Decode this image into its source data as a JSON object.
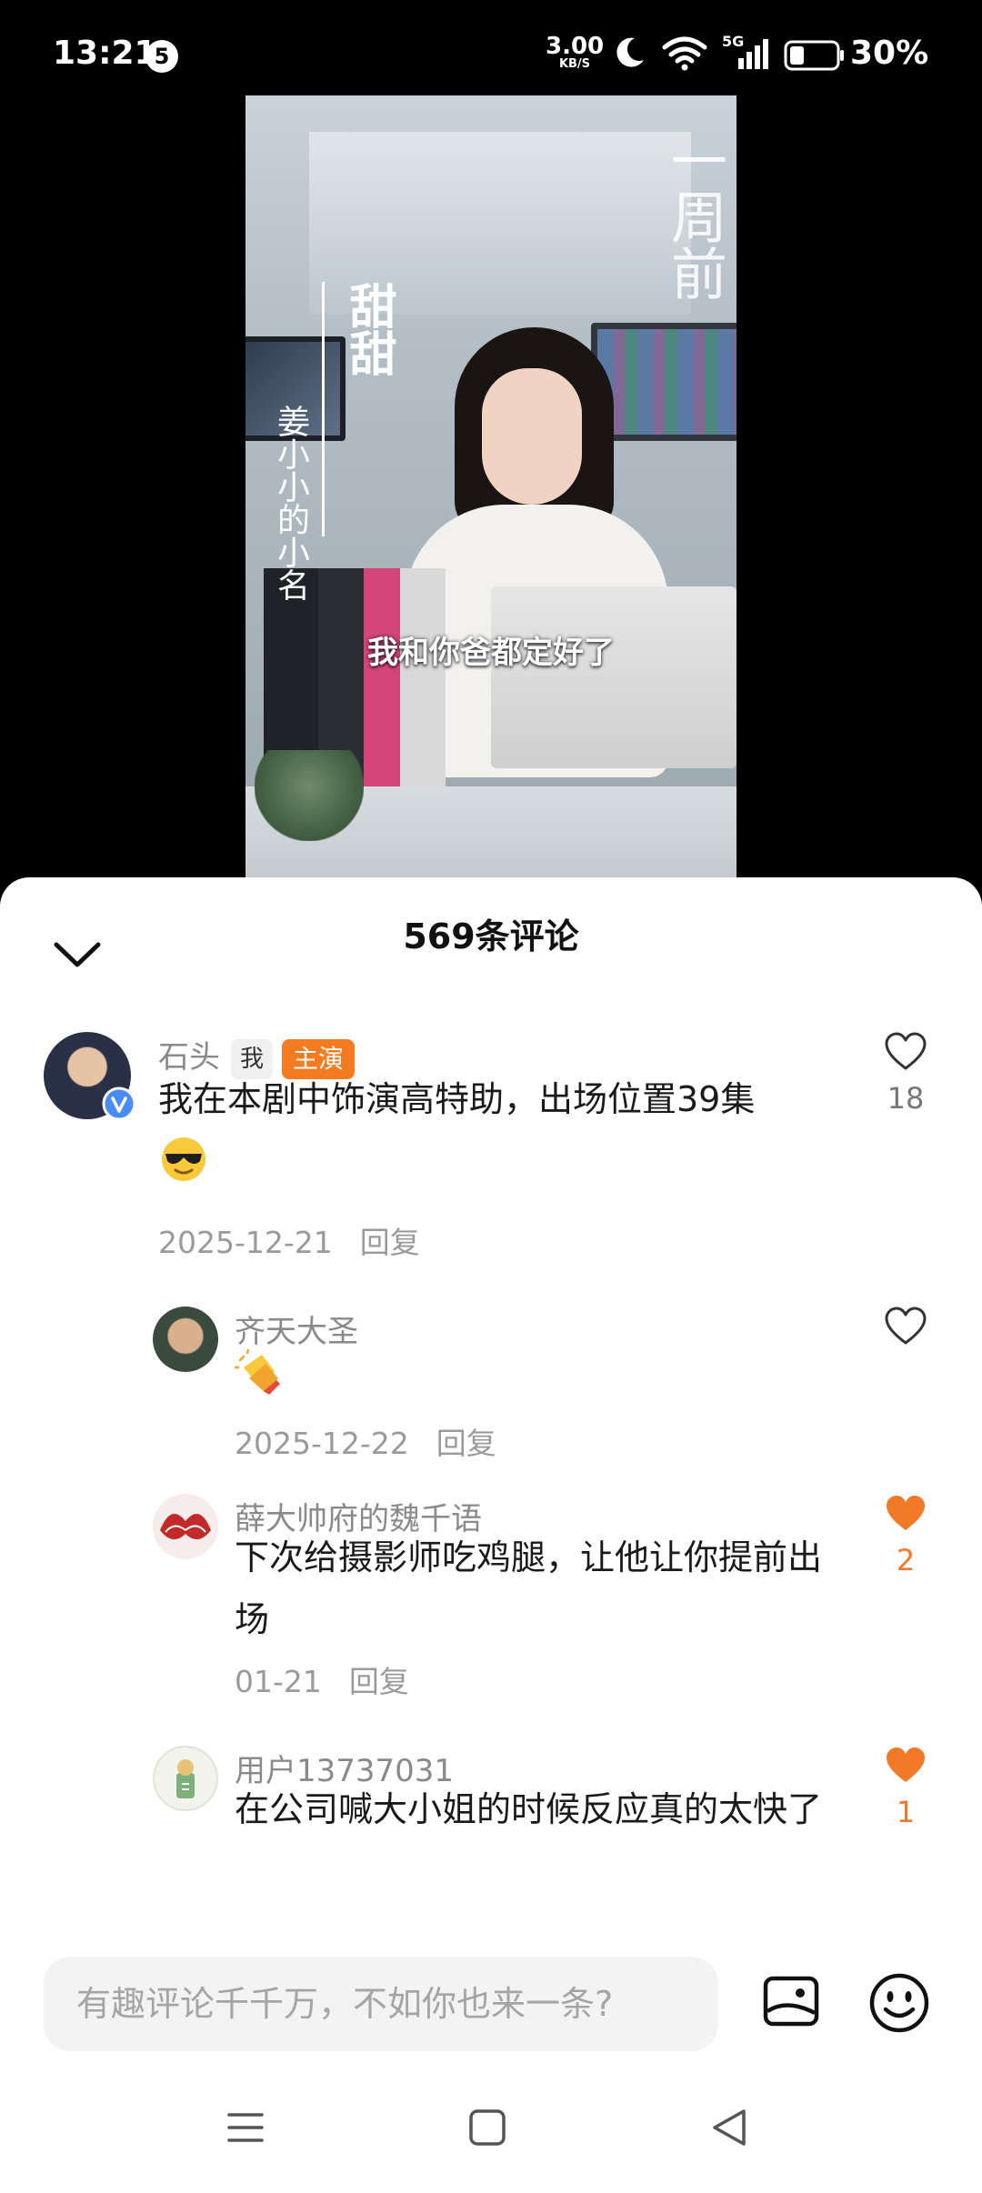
{
  "status_bar": {
    "time": "13:21",
    "notification_count": "5",
    "net_speed_value": "3.00",
    "net_speed_unit": "KB/S",
    "network": "5G",
    "battery": "30%"
  },
  "video": {
    "character_name": "甜甜",
    "character_note": "姜小小的小名",
    "time_mark": "一周前",
    "subtitle": "我和你爸都定好了"
  },
  "comments_header": {
    "title": "569条评论"
  },
  "comments": [
    {
      "user": "石头",
      "badge_me": "我",
      "badge_lead": "主演",
      "text": "我在本剧中饰演高特助，出场位置39集",
      "emoji": "sunglasses-emoji",
      "date": "2025-12-21",
      "reply": "回复",
      "likes": "18",
      "liked": false
    },
    {
      "user": "齐天大圣",
      "emoji": "clapping-hands-emoji",
      "date": "2025-12-22",
      "reply": "回复",
      "likes": "",
      "liked": false
    },
    {
      "user": "薛大帅府的魏千语",
      "text": "下次给摄影师吃鸡腿，让他让你提前出场",
      "date": "01-21",
      "reply": "回复",
      "likes": "2",
      "liked": true
    },
    {
      "user": "用户13737031",
      "text": "在公司喊大小姐的时候反应真的太快了",
      "likes": "1",
      "liked": true
    }
  ],
  "input": {
    "placeholder": "有趣评论千千万，不如你也来一条?"
  },
  "icons": {
    "collapse": "chevron-down-icon",
    "image": "image-icon",
    "emoji": "emoji-icon",
    "like": "heart-icon"
  },
  "colors": {
    "accent": "#f47b20",
    "like_active": "#f07a27"
  }
}
